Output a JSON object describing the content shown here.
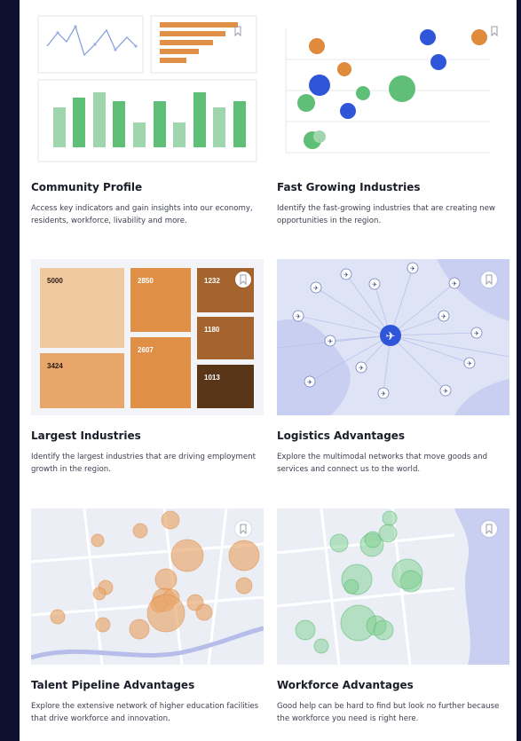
{
  "cards": [
    {
      "title": "Community Profile",
      "description": "Access key indicators and gain insights into our economy, residents, workforce, livability and more.",
      "bookmark_icon": "bookmark-icon"
    },
    {
      "title": "Fast Growing Industries",
      "description": "Identify the fast-growing industries that are creating new opportunities in the region.",
      "bookmark_icon": "bookmark-icon"
    },
    {
      "title": "Largest Industries",
      "description": "Identify the largest industries that are driving employment growth in the region.",
      "bookmark_icon": "bookmark-icon"
    },
    {
      "title": "Logistics Advantages",
      "description": "Explore the multimodal networks that move goods and services and connect us to the world.",
      "bookmark_icon": "bookmark-icon"
    },
    {
      "title": "Talent Pipeline Advantages",
      "description": "Explore the extensive network of higher education facilities that drive workforce and innovation.",
      "bookmark_icon": "bookmark-icon"
    },
    {
      "title": "Workforce Advantages",
      "description": "Good help can be hard to find but look no further because the workforce you need is right here.",
      "bookmark_icon": "bookmark-icon"
    }
  ],
  "treemap": {
    "values": [
      "5000",
      "2850",
      "1232",
      "1180",
      "2607",
      "3424",
      "1013"
    ],
    "colors": {
      "light": "#f1c9a0",
      "mid": "#e08f47",
      "dark": "#a5642e",
      "darkest": "#5a3619"
    }
  },
  "colors": {
    "accent_blue": "#2f56d9",
    "accent_orange": "#e08a3c",
    "accent_green": "#5fbf76",
    "map_bg": "#dfe3f6"
  }
}
